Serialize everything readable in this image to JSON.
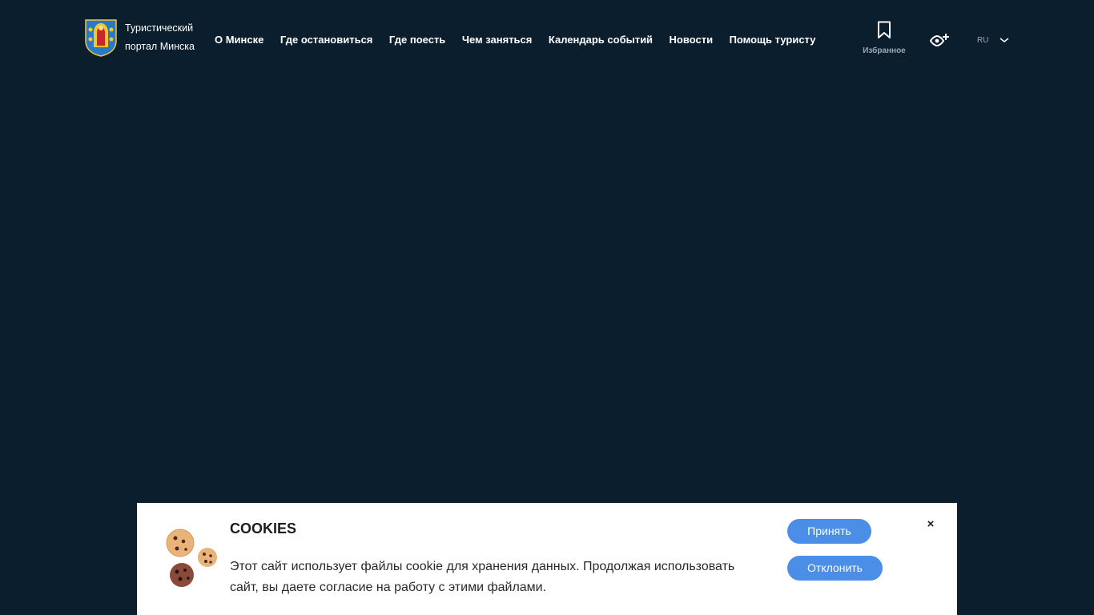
{
  "header": {
    "logo_line1": "Туристический",
    "logo_line2": "портал Минска",
    "nav": [
      {
        "label": "О Минске"
      },
      {
        "label": "Где остановиться"
      },
      {
        "label": "Где поесть"
      },
      {
        "label": "Чем заняться"
      },
      {
        "label": "Календарь событий"
      },
      {
        "label": "Новости"
      },
      {
        "label": "Помощь туристу"
      }
    ],
    "favorites_label": "Избранное",
    "language": "RU"
  },
  "cookie_banner": {
    "title": "COOKIES",
    "text": "Этот сайт использует файлы cookie для хранения данных. Продолжая использовать сайт, вы даете согласие на работу с этими файлами.",
    "accept_label": "Принять",
    "decline_label": "Отклонить",
    "close_label": "×"
  },
  "colors": {
    "background": "#0a1e2d",
    "accent": "#4a8ee8",
    "muted_text": "#9aa8b4"
  }
}
